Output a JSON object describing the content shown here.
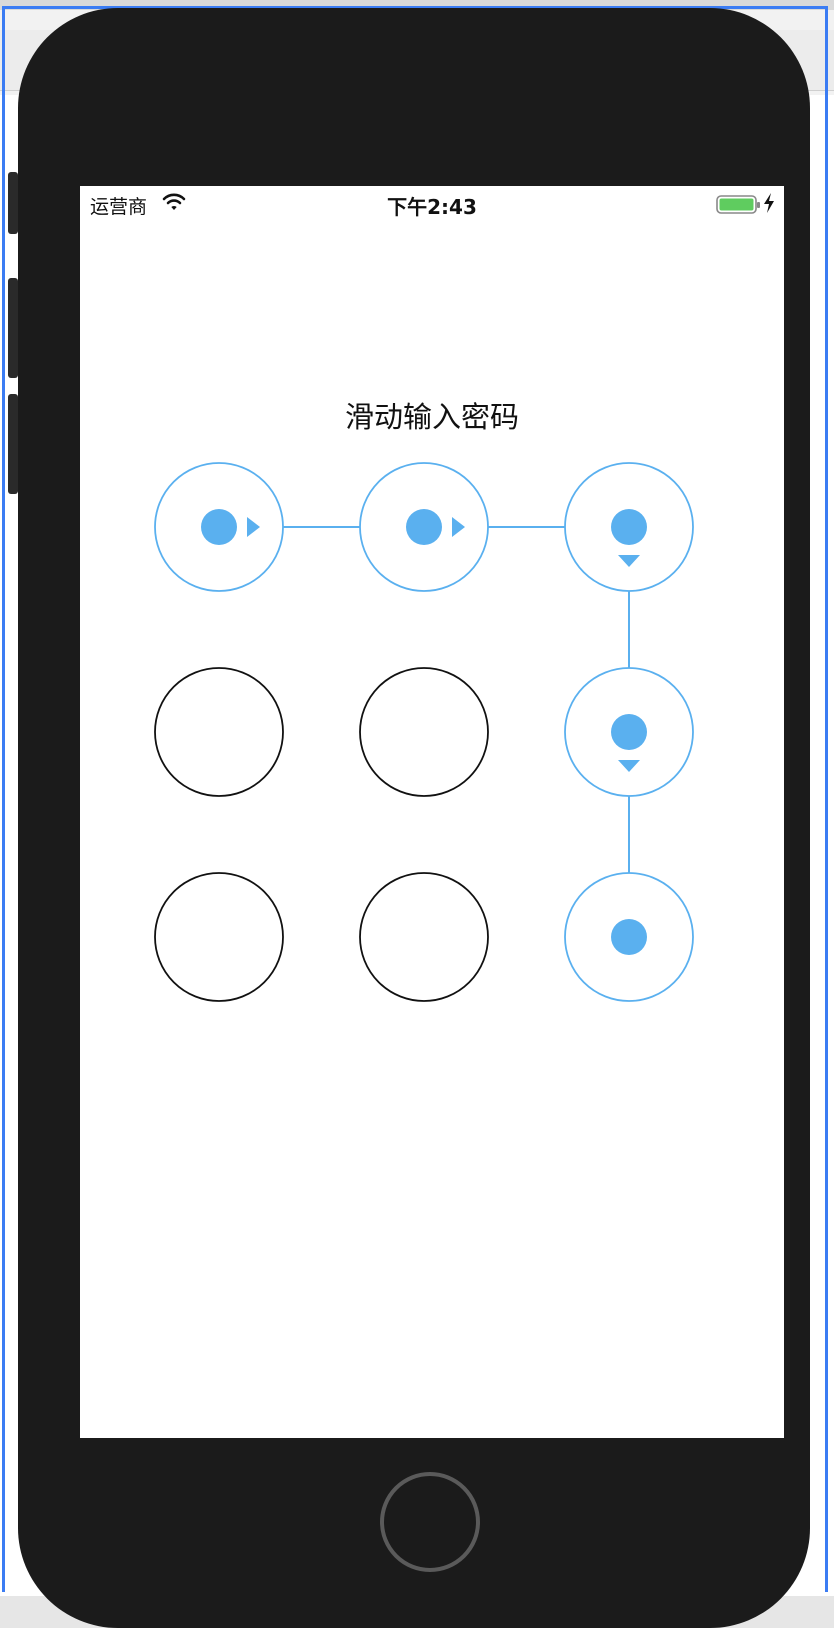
{
  "status_bar": {
    "carrier": "运营商",
    "time": "下午2:43",
    "battery_color": "#5fcc5f"
  },
  "screen": {
    "title": "滑动输入密码"
  },
  "pattern": {
    "active_color": "#5ab0ef",
    "inactive_color": "#111111",
    "nodes": [
      {
        "id": 1,
        "selected": true,
        "direction": "right"
      },
      {
        "id": 2,
        "selected": true,
        "direction": "right"
      },
      {
        "id": 3,
        "selected": true,
        "direction": "down"
      },
      {
        "id": 4,
        "selected": false,
        "direction": ""
      },
      {
        "id": 5,
        "selected": false,
        "direction": ""
      },
      {
        "id": 6,
        "selected": true,
        "direction": "down"
      },
      {
        "id": 7,
        "selected": false,
        "direction": ""
      },
      {
        "id": 8,
        "selected": false,
        "direction": ""
      },
      {
        "id": 9,
        "selected": true,
        "direction": ""
      }
    ],
    "sequence": [
      1,
      2,
      3,
      6,
      9
    ]
  }
}
